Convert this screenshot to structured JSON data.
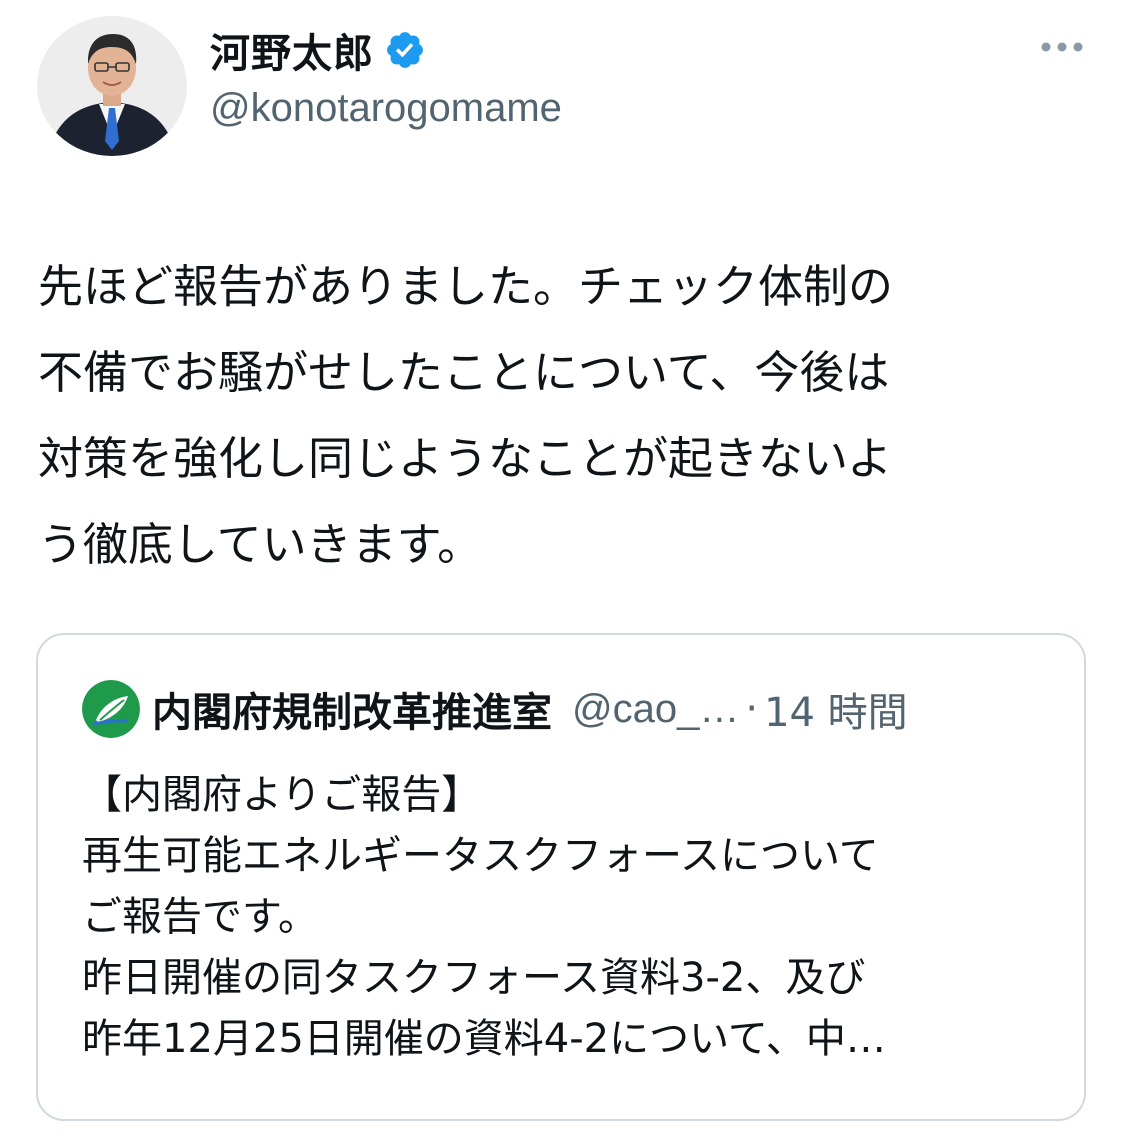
{
  "author": {
    "display_name": "河野太郎",
    "handle": "@konotarogomame",
    "avatar_icon": "person-portrait-icon",
    "verified_icon": "verified-badge-icon",
    "verified_color": "#1d9bf0"
  },
  "more_icon": "more-horizontal-icon",
  "tweet": {
    "text": "先ほど報告がありました。チェック体制の\n不備でお騒がせしたことについて、今後は\n対策を強化し同じようなことが起きないよ\nう徹底していきます。"
  },
  "quoted_tweet": {
    "display_name": "内閣府規制改革推進室",
    "handle": "@cao_…",
    "separator": "·",
    "time": "14 時間",
    "avatar_icon": "leaf-logo-icon",
    "avatar_color": "#1f9a4a",
    "text": "【内閣府よりご報告】\n再生可能エネルギータスクフォースについて\nご報告です。\n昨日開催の同タスクフォース資料3-2、及び\n昨年12月25日開催の資料4-2について、中…"
  },
  "colors": {
    "text_primary": "#0f1419",
    "text_secondary": "#536471",
    "border": "#cfd9de"
  }
}
